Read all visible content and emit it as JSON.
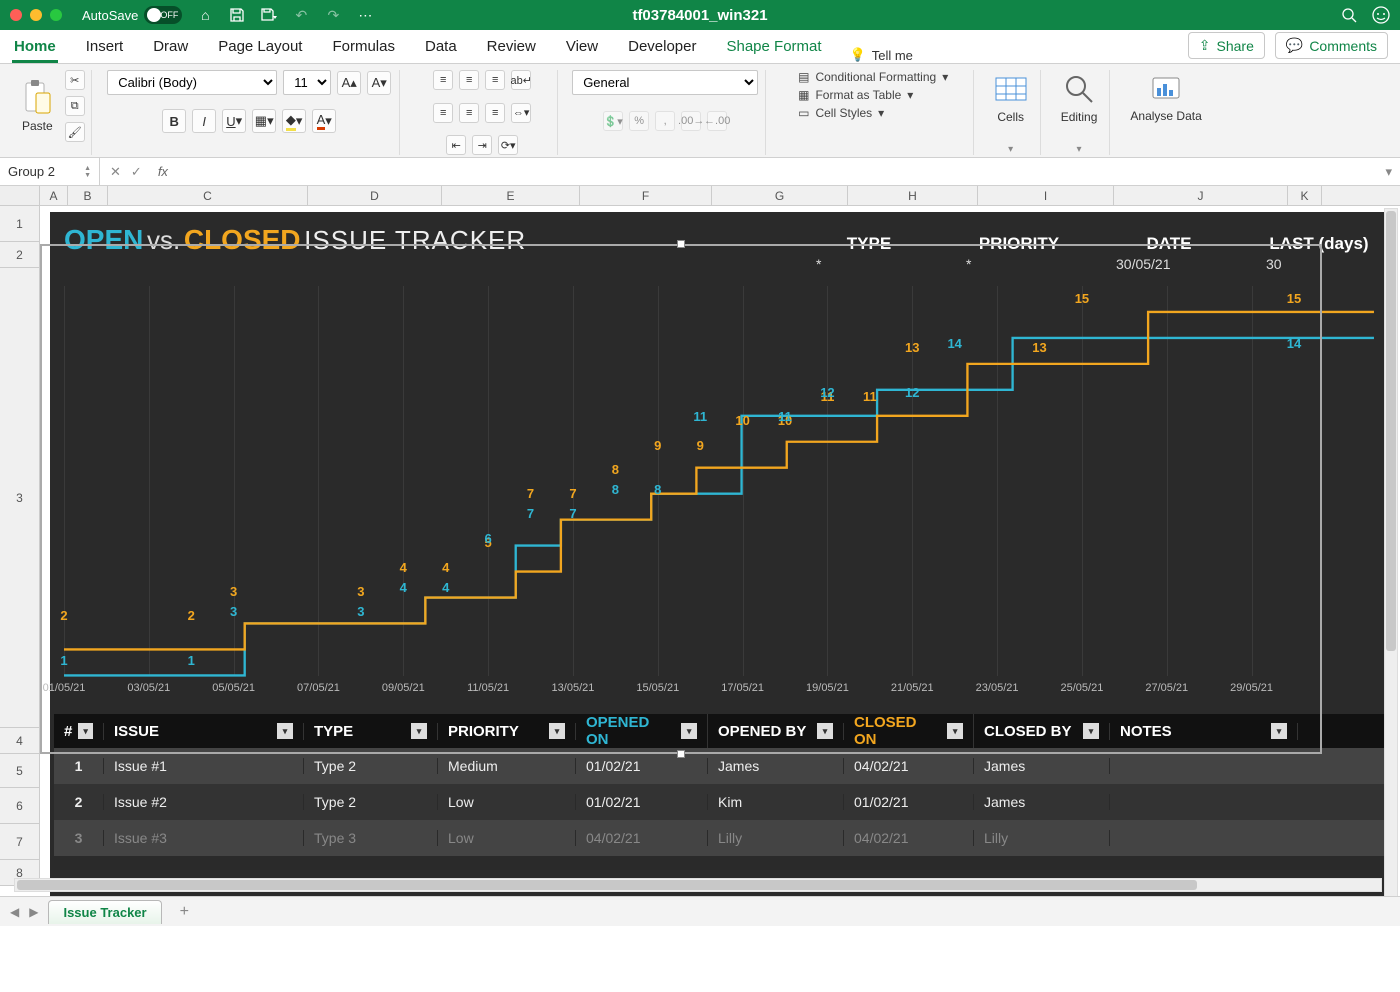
{
  "titlebar": {
    "autosave_label": "AutoSave",
    "autosave_state": "OFF",
    "filename": "tf03784001_win321"
  },
  "tabs": [
    "Home",
    "Insert",
    "Draw",
    "Page Layout",
    "Formulas",
    "Data",
    "Review",
    "View",
    "Developer",
    "Shape Format"
  ],
  "tellme": "Tell me",
  "share": "Share",
  "comments": "Comments",
  "ribbon": {
    "paste": "Paste",
    "font_name": "Calibri (Body)",
    "font_size": "11",
    "number_format": "General",
    "cond_fmt": "Conditional Formatting",
    "as_table": "Format as Table",
    "cell_styles": "Cell Styles",
    "cells": "Cells",
    "editing": "Editing",
    "analyse": "Analyse Data"
  },
  "namebox": "Group 2",
  "fx": "fx",
  "columns": [
    "A",
    "B",
    "C",
    "D",
    "E",
    "F",
    "G",
    "H",
    "I",
    "J",
    "K"
  ],
  "rows_visible": [
    1,
    2,
    3,
    4,
    5,
    6,
    7,
    8
  ],
  "tracker": {
    "title_open": "OPEN",
    "title_vs": "vs.",
    "title_closed": "CLOSED",
    "title_rest": "ISSUE TRACKER",
    "filters": {
      "type_label": "TYPE",
      "type_value": "*",
      "priority_label": "PRIORITY",
      "priority_value": "*",
      "date_label": "DATE",
      "date_value": "30/05/21",
      "last_label": "LAST (days)",
      "last_value": "30"
    }
  },
  "chart_data": {
    "type": "line",
    "x_tick_labels": [
      "01/05/21",
      "03/05/21",
      "05/05/21",
      "07/05/21",
      "09/05/21",
      "11/05/21",
      "13/05/21",
      "15/05/21",
      "17/05/21",
      "19/05/21",
      "21/05/21",
      "23/05/21",
      "25/05/21",
      "27/05/21",
      "29/05/21"
    ],
    "ylim": [
      0,
      16
    ],
    "series": [
      {
        "name": "Open (blue)",
        "color": "#2fb6d3",
        "values": [
          1,
          1,
          1,
          1,
          3,
          3,
          3,
          3,
          4,
          4,
          6,
          7,
          7,
          8,
          8,
          11,
          11,
          11,
          12,
          12,
          12,
          14,
          14,
          14,
          14,
          14,
          14,
          14,
          14,
          14
        ]
      },
      {
        "name": "Closed (orange)",
        "color": "#f2a61f",
        "values": [
          2,
          2,
          2,
          2,
          3,
          3,
          3,
          3,
          4,
          4,
          5,
          7,
          7,
          8,
          9,
          9,
          10,
          10,
          11,
          11,
          13,
          13,
          13,
          13,
          15,
          15,
          15,
          15,
          15,
          15
        ]
      }
    ]
  },
  "table": {
    "headers": [
      "#",
      "ISSUE",
      "TYPE",
      "PRIORITY",
      "OPENED ON",
      "OPENED BY",
      "CLOSED ON",
      "CLOSED BY",
      "NOTES"
    ],
    "rows": [
      {
        "num": "1",
        "issue": "Issue #1",
        "type": "Type 2",
        "priority": "Medium",
        "opened_on": "01/02/21",
        "opened_by": "James",
        "closed_on": "04/02/21",
        "closed_by": "James",
        "notes": ""
      },
      {
        "num": "2",
        "issue": "Issue #2",
        "type": "Type 2",
        "priority": "Low",
        "opened_on": "01/02/21",
        "opened_by": "Kim",
        "closed_on": "01/02/21",
        "closed_by": "James",
        "notes": ""
      },
      {
        "num": "3",
        "issue": "Issue #3",
        "type": "Type 3",
        "priority": "Low",
        "opened_on": "04/02/21",
        "opened_by": "Lilly",
        "closed_on": "04/02/21",
        "closed_by": "Lilly",
        "notes": ""
      }
    ]
  },
  "sheet_tab": "Issue Tracker"
}
